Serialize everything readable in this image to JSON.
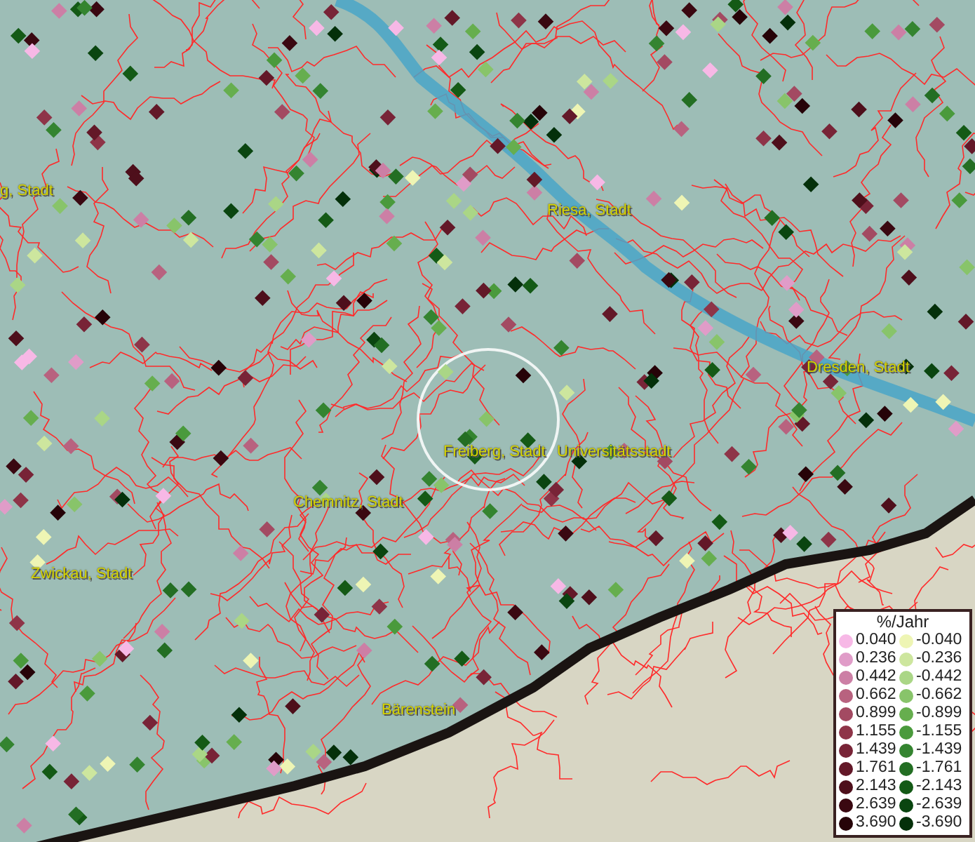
{
  "map": {
    "place_labels": [
      {
        "text": "g, Stadt"
      },
      {
        "text": "Riesa, Stadt"
      },
      {
        "text": "Dresden, Stadt"
      },
      {
        "text": "Freiberg, Stadt"
      },
      {
        "text": "Universitätsstadt"
      },
      {
        "text": "Chemnitz, Stadt"
      },
      {
        "text": "Zwickau, Stadt"
      },
      {
        "text": "Bärenstein"
      }
    ]
  },
  "legend": {
    "title": "%/Jahr",
    "rows": [
      [
        {
          "label": "0.040",
          "color": "#f7b8e6"
        },
        {
          "label": "-0.040",
          "color": "#eef5b4"
        }
      ],
      [
        {
          "label": "0.236",
          "color": "#e09cc8"
        },
        {
          "label": "-0.236",
          "color": "#cde69e"
        }
      ],
      [
        {
          "label": "0.442",
          "color": "#cc7fa5"
        },
        {
          "label": "-0.442",
          "color": "#aad686"
        }
      ],
      [
        {
          "label": "0.662",
          "color": "#b8627f"
        },
        {
          "label": "-0.662",
          "color": "#88c46a"
        }
      ],
      [
        {
          "label": "0.899",
          "color": "#a34a62"
        },
        {
          "label": "-0.899",
          "color": "#66ae4e"
        }
      ],
      [
        {
          "label": "1.155",
          "color": "#8e3448"
        },
        {
          "label": "-1.155",
          "color": "#4a9a3c"
        }
      ],
      [
        {
          "label": "1.439",
          "color": "#782437"
        },
        {
          "label": "-1.439",
          "color": "#348430"
        }
      ],
      [
        {
          "label": "1.761",
          "color": "#631828"
        },
        {
          "label": "-1.761",
          "color": "#236e23"
        }
      ],
      [
        {
          "label": "2.143",
          "color": "#4e0f1b"
        },
        {
          "label": "-2.143",
          "color": "#145a16"
        }
      ],
      [
        {
          "label": "2.639",
          "color": "#3a0811"
        },
        {
          "label": "-2.639",
          "color": "#0a4510"
        }
      ],
      [
        {
          "label": "3.690",
          "color": "#260308"
        },
        {
          "label": "-3.690",
          "color": "#04300a"
        }
      ]
    ]
  }
}
